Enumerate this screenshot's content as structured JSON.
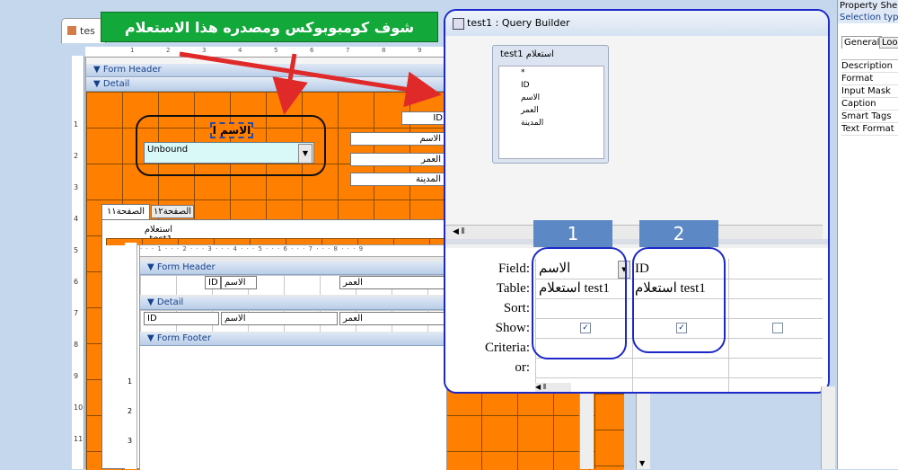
{
  "annotation": {
    "text": "شوف كومبوبوكس ومصدره هذا الاستعلام",
    "badge1": "1",
    "badge2": "2"
  },
  "form_tab": {
    "label": "tes"
  },
  "form": {
    "header_label": "Form Header",
    "detail_label": "Detail",
    "id_box": "ID",
    "combo_label": "الاسم ا",
    "combo_value": "Unbound",
    "fields": [
      "الاسم",
      "العمر",
      "المدينة"
    ],
    "tabs": [
      "الصفحة١١",
      "الصفحة١٢"
    ],
    "subform_label": "استعلام test1",
    "sub_header_label": "Form Header",
    "sub_detail_label": "Detail",
    "sub_footer_label": "Form Footer",
    "sub_header_cells": [
      "ID",
      "الاسم",
      "العمر"
    ],
    "sub_detail_cells": [
      "ID",
      "الاسم",
      "العمر"
    ]
  },
  "ruler_ticks": [
    "1",
    "2",
    "3",
    "4",
    "5",
    "6",
    "7",
    "8",
    "9",
    "10",
    "11"
  ],
  "sub_ruler_ticks": [
    "1",
    "2",
    "3"
  ],
  "query_builder": {
    "title": "test1 : Query Builder",
    "table_title": "استعلام test1",
    "table_fields": [
      "*",
      "ID",
      "الاسم",
      "العمر",
      "المدينة"
    ],
    "row_labels": [
      "Field:",
      "Table:",
      "Sort:",
      "Show:",
      "Criteria:",
      "or:"
    ],
    "col1": {
      "field": "الاسم",
      "table": "استعلام test1",
      "show": true
    },
    "col2": {
      "field": "ID",
      "table": "استعلام test1",
      "show": true
    },
    "col3": {
      "show": false
    }
  },
  "property_sheet": {
    "title": "Property Shee",
    "selection": "Selection type",
    "tabs": [
      "General",
      "Look"
    ],
    "rows": [
      "Description",
      "Format",
      "Input Mask",
      "Caption",
      "Smart Tags",
      "Text Format"
    ]
  },
  "colors": {
    "orange": "#ff7f00",
    "annotation_bg": "#12a83a",
    "badge": "#5c88c6",
    "outline": "#1c28c8"
  }
}
